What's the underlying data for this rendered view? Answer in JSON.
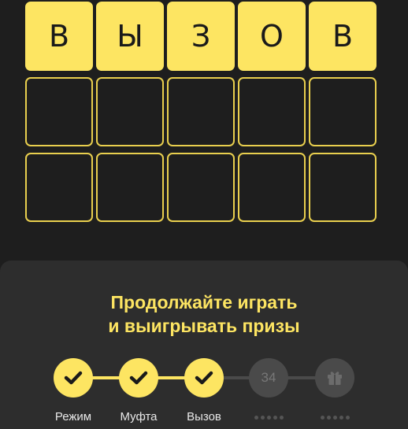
{
  "board": {
    "rows": [
      [
        "В",
        "Ы",
        "З",
        "О",
        "В"
      ],
      [
        "",
        "",
        "",
        "",
        ""
      ],
      [
        "",
        "",
        "",
        "",
        ""
      ]
    ]
  },
  "panel": {
    "title_line1": "Продолжайте играть",
    "title_line2": "и выигрывать призы"
  },
  "progress": {
    "steps": [
      {
        "label": "Режим",
        "status": "done",
        "icon": "check-icon"
      },
      {
        "label": "Муфта",
        "status": "done",
        "icon": "check-icon"
      },
      {
        "label": "Вызов",
        "status": "done",
        "icon": "check-icon"
      },
      {
        "number": "34",
        "status": "locked"
      },
      {
        "status": "locked",
        "icon": "gift-icon"
      }
    ]
  },
  "colors": {
    "background": "#1e1e1e",
    "panel": "#2d2d2d",
    "accent": "#fde562",
    "inactive": "#4a4a4a"
  }
}
